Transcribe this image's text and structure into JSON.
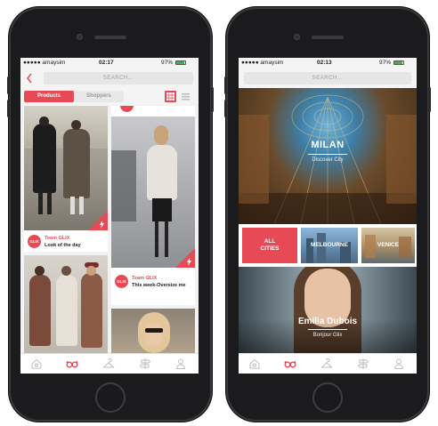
{
  "left_phone": {
    "status": {
      "carrier": "●●●●● amaysim",
      "time": "02:17",
      "battery": "97%"
    },
    "search": {
      "placeholder": "SEARCH..."
    },
    "back_icon": "chevron-left-icon",
    "segments": {
      "products": "Products",
      "shoppers": "Shoppers",
      "active": "products"
    },
    "view_icons": [
      "grid-view-icon",
      "list-view-icon"
    ],
    "cards": [
      {
        "author": "Team GLIX",
        "caption": "Look of the day",
        "badge": "GLIX"
      },
      {
        "author": "Team GLIX",
        "caption": "This week-Oversize me",
        "badge": "GLIX"
      }
    ],
    "tabbar": [
      "home-icon",
      "glasses-icon",
      "hanger-icon",
      "signpost-icon",
      "profile-icon"
    ]
  },
  "right_phone": {
    "status": {
      "carrier": "●●●●● amaysim",
      "time": "02:13",
      "battery": "97%"
    },
    "search": {
      "placeholder": "SEARCH..."
    },
    "hero": {
      "city": "MILAN",
      "subtitle": "Discover City"
    },
    "cities": {
      "all": "ALL\nCITIES",
      "melbourne": "MELBOURNE",
      "venice": "VENICE"
    },
    "featured": {
      "name": "Emilia Dubois",
      "subtitle": "Bonjour Glix"
    },
    "tabbar": [
      "home-icon",
      "glasses-icon",
      "hanger-icon",
      "signpost-icon",
      "profile-icon"
    ]
  },
  "colors": {
    "accent": "#e84a55",
    "screen_bg": "#f3f3f3",
    "phone_body": "#1b1b1d"
  }
}
